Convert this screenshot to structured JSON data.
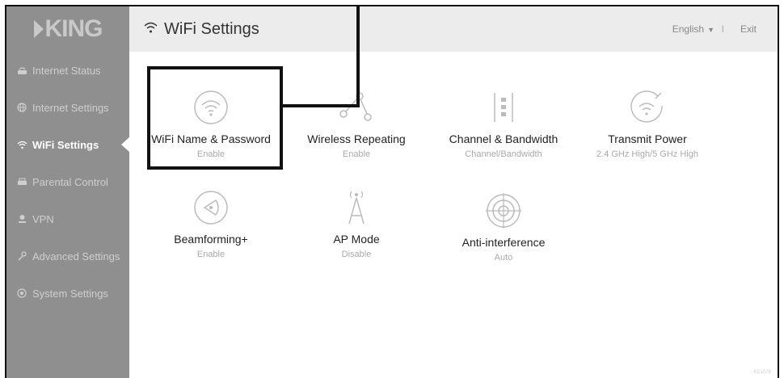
{
  "brand": {
    "logo_text": "KING"
  },
  "header": {
    "title": "WiFi Settings",
    "language": "English",
    "separator": "I",
    "exit_label": "Exit"
  },
  "sidebar": {
    "items": [
      {
        "label": "Internet Status",
        "icon": "router-icon"
      },
      {
        "label": "Internet Settings",
        "icon": "globe-icon"
      },
      {
        "label": "WiFi Settings",
        "icon": "wifi-icon",
        "active": true
      },
      {
        "label": "Parental Control",
        "icon": "parental-icon"
      },
      {
        "label": "VPN",
        "icon": "vpn-icon"
      },
      {
        "label": "Advanced Settings",
        "icon": "wrench-icon"
      },
      {
        "label": "System Settings",
        "icon": "settings-icon"
      }
    ]
  },
  "tiles": [
    {
      "label": "WiFi Name & Password",
      "sub": "Enable",
      "icon": "wifi-circle-icon"
    },
    {
      "label": "Wireless Repeating",
      "sub": "Enable",
      "icon": "repeater-icon"
    },
    {
      "label": "Channel & Bandwidth",
      "sub": "Channel/Bandwidth",
      "icon": "channel-icon"
    },
    {
      "label": "Transmit Power",
      "sub": "2.4 GHz High/5 GHz High",
      "icon": "transmit-power-icon"
    },
    {
      "label": "Beamforming+",
      "sub": "Enable",
      "icon": "beamforming-icon"
    },
    {
      "label": "AP Mode",
      "sub": "Disable",
      "icon": "antenna-icon"
    },
    {
      "label": "Anti-interference",
      "sub": "Auto",
      "icon": "target-icon"
    }
  ],
  "footer": {
    "code": "KC1078"
  }
}
